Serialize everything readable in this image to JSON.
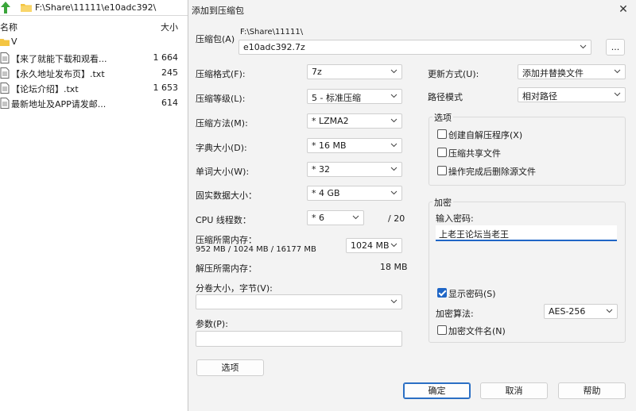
{
  "file_manager": {
    "path": "F:\\Share\\11111\\e10adc392\\",
    "columns": {
      "name": "名称",
      "size": "大小"
    },
    "rows": [
      {
        "name": "V",
        "size": "",
        "icon": "folder-icon"
      },
      {
        "name": "【来了就能下载和观看...",
        "size": "1 664",
        "icon": "text-file-icon"
      },
      {
        "name": "【永久地址发布页】.txt",
        "size": "245",
        "icon": "text-file-icon"
      },
      {
        "name": "【论坛介绍】.txt",
        "size": "1 653",
        "icon": "text-file-icon"
      },
      {
        "name": "最新地址及APP请发邮...",
        "size": "614",
        "icon": "text-file-icon"
      }
    ]
  },
  "dialog": {
    "title": "添加到压缩包",
    "archive": {
      "label": "压缩包(A)",
      "folder": "F:\\Share\\11111\\",
      "filename": "e10adc392.7z",
      "browse_label": "..."
    },
    "left_fields": {
      "format": {
        "label": "压缩格式(F):",
        "value": "7z"
      },
      "level": {
        "label": "压缩等级(L):",
        "value": "5 - 标准压缩"
      },
      "method": {
        "label": "压缩方法(M):",
        "value": "*  LZMA2"
      },
      "dict": {
        "label": "字典大小(D):",
        "value": "*  16 MB"
      },
      "word": {
        "label": "单词大小(W):",
        "value": "*  32"
      },
      "solid": {
        "label": "固实数据大小：",
        "value": "*  4 GB"
      },
      "threads": {
        "label": "CPU 线程数：",
        "value": "*  6",
        "max": "/ 20"
      }
    },
    "memory": {
      "compress_label": "压缩所需内存：",
      "compress_detail": "952 MB / 1024 MB / 16177 MB",
      "compress_select": "1024 MB",
      "decompress_label": "解压所需内存：",
      "decompress_value": "18 MB"
    },
    "split": {
      "label": "分卷大小，字节(V):",
      "value": ""
    },
    "params": {
      "label": "参数(P):",
      "value": ""
    },
    "options_button": "选项",
    "update": {
      "label": "更新方式(U):",
      "value": "添加并替换文件"
    },
    "path_mode": {
      "label": "路径模式",
      "value": "相对路径"
    },
    "options_group": {
      "title": "选项",
      "items": [
        {
          "label": "创建自解压程序(X)",
          "checked": false
        },
        {
          "label": "压缩共享文件",
          "checked": false
        },
        {
          "label": "操作完成后删除源文件",
          "checked": false
        }
      ]
    },
    "encryption": {
      "title": "加密",
      "password_label": "输入密码:",
      "password_value": "上老王论坛当老王",
      "show_password": {
        "label": "显示密码(S)",
        "checked": true
      },
      "method_label": "加密算法:",
      "method_value": "AES-256",
      "encrypt_names": {
        "label": "加密文件名(N)",
        "checked": false
      }
    },
    "buttons": {
      "ok": "确定",
      "cancel": "取消",
      "help": "帮助"
    }
  },
  "colors": {
    "accent": "#1f66c6",
    "dialog_bg": "#f3f3f3",
    "folder": "#f4c542"
  }
}
